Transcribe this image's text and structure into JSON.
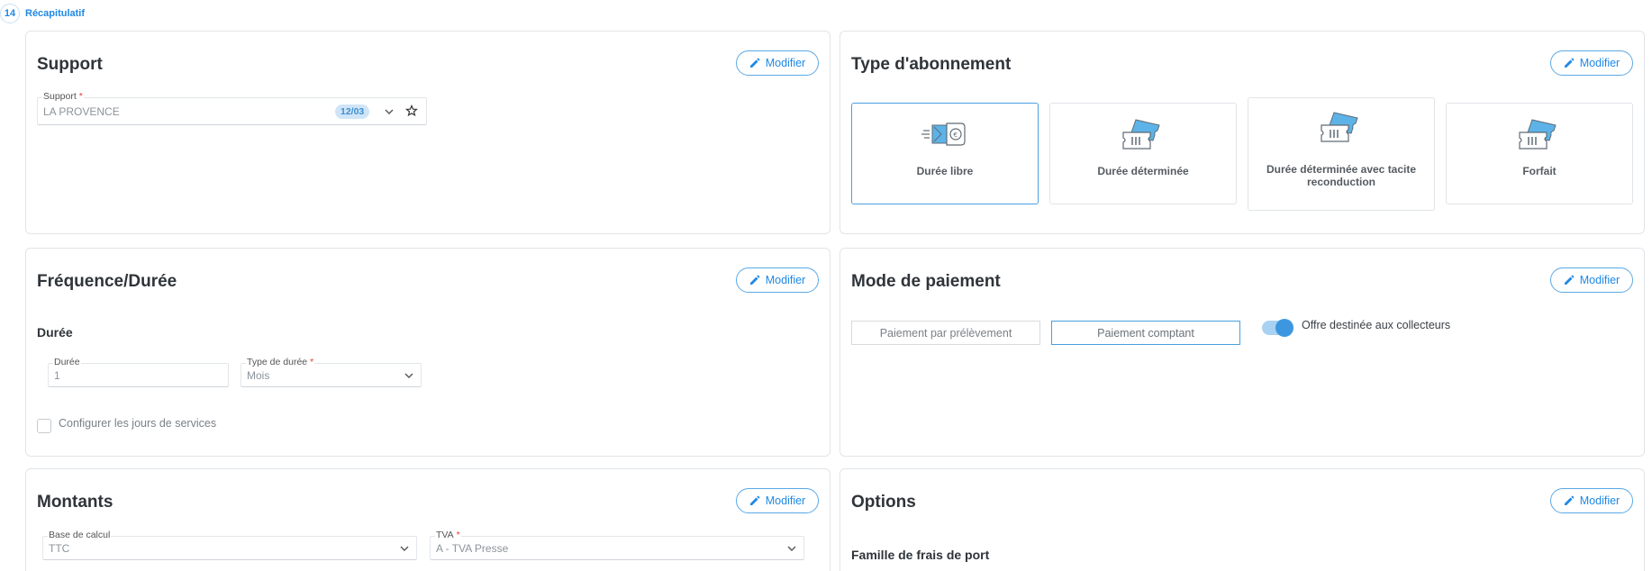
{
  "step": {
    "number": "14",
    "title": "Récapitulatif"
  },
  "modifier_label": "Modifier",
  "support": {
    "title": "Support",
    "field_label": "Support",
    "value": "LA PROVENCE",
    "badge": "12/03"
  },
  "abonnement": {
    "title": "Type d'abonnement",
    "tiles": [
      {
        "label": "Durée libre",
        "icon": "wallet-icon",
        "selected": true
      },
      {
        "label": "Durée déterminée",
        "icon": "tickets-icon",
        "selected": false
      },
      {
        "label": "Durée déterminée avec tacite reconduction",
        "icon": "tickets-icon",
        "selected": false
      },
      {
        "label": "Forfait",
        "icon": "tickets-icon",
        "selected": false
      }
    ]
  },
  "frequence": {
    "title": "Fréquence/Durée",
    "subtitle": "Durée",
    "duree_label": "Durée",
    "duree_value": "1",
    "type_label": "Type de durée",
    "type_value": "Mois",
    "checkbox_label": "Configurer les jours de services"
  },
  "paiement": {
    "title": "Mode de paiement",
    "option1": "Paiement par prélèvement",
    "option2": "Paiement comptant",
    "toggle_label": "Offre destinée aux collecteurs"
  },
  "montants": {
    "title": "Montants",
    "base_label": "Base de calcul",
    "base_value": "TTC",
    "tva_label": "TVA",
    "tva_value": "A - TVA Presse"
  },
  "options": {
    "title": "Options",
    "subtitle": "Famille de frais de port"
  },
  "colors": {
    "accent": "#1e88e5",
    "required": "#e53935",
    "badge_bg": "#cfe5f7"
  }
}
